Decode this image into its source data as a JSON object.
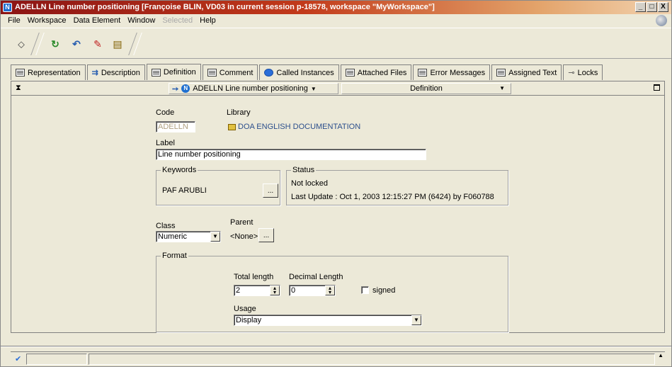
{
  "window": {
    "title": "ADELLN Line number positioning [Françoise BLIN, VD03 in current session p-18578, workspace \"MyWorkspace\"]",
    "app_icon_label": "N",
    "minimize": "_",
    "maximize": "□",
    "close": "X"
  },
  "menu": {
    "file": "File",
    "workspace": "Workspace",
    "data_element": "Data Element",
    "window": "Window",
    "selected": "Selected",
    "help": "Help"
  },
  "toolbar": {
    "icons": [
      "pin-icon",
      "refresh-icon",
      "undo-icon",
      "edit-icon",
      "document-icon"
    ]
  },
  "tabs": [
    {
      "label": "Representation",
      "icon": "list-icon"
    },
    {
      "label": "Description",
      "icon": "description-icon"
    },
    {
      "label": "Definition",
      "icon": "definition-icon",
      "active": true
    },
    {
      "label": "Comment",
      "icon": "comment-icon"
    },
    {
      "label": "Called Instances",
      "icon": "instances-icon"
    },
    {
      "label": "Attached Files",
      "icon": "files-icon"
    },
    {
      "label": "Error Messages",
      "icon": "error-icon"
    },
    {
      "label": "Assigned Text",
      "icon": "text-icon"
    },
    {
      "label": "Locks",
      "icon": "lock-icon"
    }
  ],
  "pane": {
    "element_badge": "N",
    "element_name": "ADELLN Line number positioning",
    "view_name": "Definition",
    "dropdown_glyph": "▼",
    "arrow_glyph": "➙"
  },
  "form": {
    "code_label": "Code",
    "code_value": "ADELLN",
    "library_label": "Library",
    "library_value": "DOA ENGLISH DOCUMENTATION",
    "label_label": "Label",
    "label_value": "Line number positioning",
    "keywords_title": "Keywords",
    "keywords_value": "PAF ARUBLI",
    "status_title": "Status",
    "status_value": "Not locked",
    "last_update": "Last Update : Oct 1, 2003 12:15:27 PM (6424) by F060788",
    "class_label": "Class",
    "class_value": "Numeric",
    "parent_label": "Parent",
    "parent_value": "<None>",
    "ellipsis": "...",
    "format_title": "Format",
    "total_length_label": "Total length",
    "total_length_value": "2",
    "decimal_length_label": "Decimal Length",
    "decimal_length_value": "0",
    "signed_label": "signed",
    "signed_checked": false,
    "usage_label": "Usage",
    "usage_value": "Display"
  },
  "status_bar": {
    "icon": "check-icon"
  }
}
